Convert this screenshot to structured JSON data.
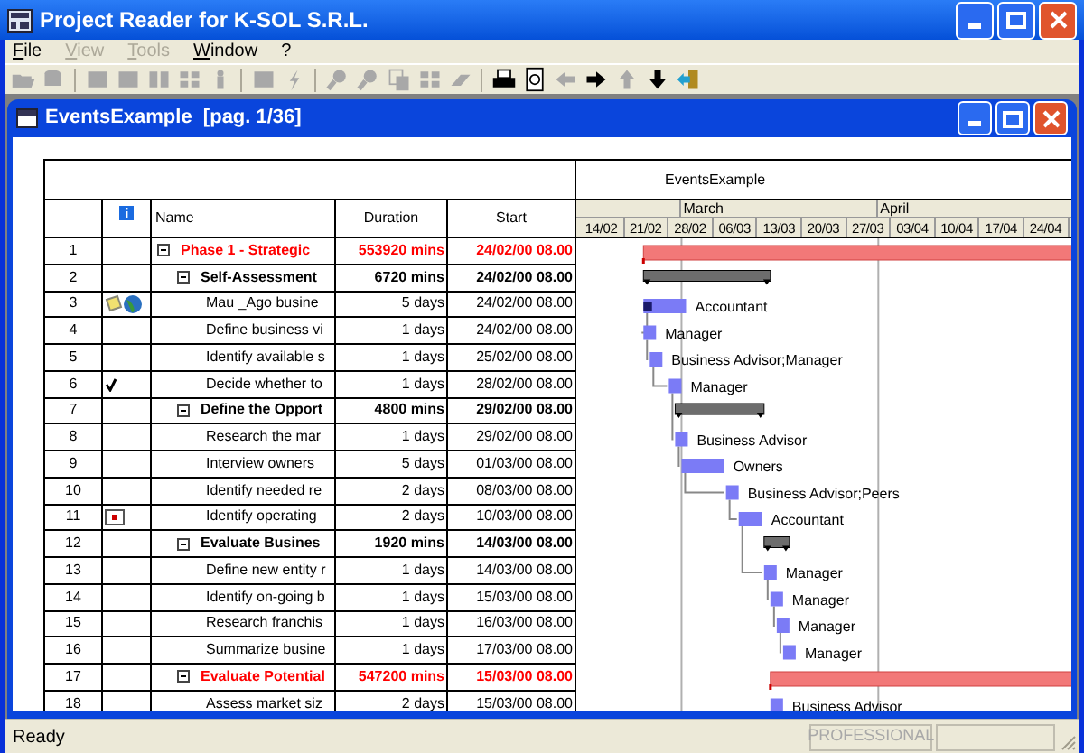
{
  "app": {
    "title": "Project Reader for K-SOL S.R.L."
  },
  "menu": [
    {
      "label": "File",
      "disabled": false
    },
    {
      "label": "View",
      "disabled": true
    },
    {
      "label": "Tools",
      "disabled": true
    },
    {
      "label": "Window",
      "disabled": false
    },
    {
      "label": "?",
      "disabled": false
    }
  ],
  "toolbar": [
    {
      "kind": "open",
      "disabled": true
    },
    {
      "kind": "database",
      "disabled": true
    },
    {
      "kind": "separator"
    },
    {
      "kind": "block",
      "disabled": true
    },
    {
      "kind": "block",
      "disabled": true
    },
    {
      "kind": "columns",
      "disabled": true
    },
    {
      "kind": "grid",
      "disabled": true
    },
    {
      "kind": "person",
      "disabled": true
    },
    {
      "kind": "separator"
    },
    {
      "kind": "block",
      "disabled": true
    },
    {
      "kind": "lightning",
      "disabled": true
    },
    {
      "kind": "separator"
    },
    {
      "kind": "zoom",
      "disabled": true
    },
    {
      "kind": "zoom",
      "disabled": true
    },
    {
      "kind": "copy",
      "disabled": true
    },
    {
      "kind": "grid",
      "disabled": true
    },
    {
      "kind": "eraser",
      "disabled": true
    },
    {
      "kind": "separator"
    },
    {
      "kind": "printer",
      "disabled": false
    },
    {
      "kind": "preview",
      "disabled": false
    },
    {
      "kind": "left",
      "disabled": true
    },
    {
      "kind": "right",
      "disabled": false
    },
    {
      "kind": "up",
      "disabled": true
    },
    {
      "kind": "down",
      "disabled": false
    },
    {
      "kind": "exit",
      "disabled": false
    }
  ],
  "document": {
    "title": "EventsExample  [pag. 1/36]",
    "gantt_title": "EventsExample",
    "columns": {
      "name": "Name",
      "duration": "Duration",
      "start": "Start"
    },
    "months": [
      "March",
      "April"
    ],
    "weeks": [
      "14/02",
      "21/02",
      "28/02",
      "06/03",
      "13/03",
      "20/03",
      "27/03",
      "03/04",
      "10/04",
      "17/04",
      "24/04"
    ],
    "rows": [
      {
        "number": "1",
        "kind": "summary",
        "critical": true,
        "expanded": true,
        "name": "Phase 1 - Strategic",
        "duration": "553920 mins",
        "start": "24/02/00 08.00",
        "children": [
          {
            "number": "2",
            "kind": "summary",
            "critical": false,
            "expanded": true,
            "name": "Self-Assessment",
            "duration": "6720 mins",
            "start": "24/02/00 08.00",
            "children": [
              {
                "number": "3",
                "kind": "task",
                "indicators": [
                  {
                    "kind": "note"
                  },
                  {
                    "kind": "globe"
                  }
                ],
                "name": "Mau _Ago busine",
                "duration": "5 days",
                "start": "24/02/00 08.00",
                "resource": "Accountant",
                "level": 0.2
              },
              {
                "number": "4",
                "kind": "task",
                "name": "Define business vi",
                "duration": "1 days",
                "start": "24/02/00 08.00",
                "resource": "Manager"
              },
              {
                "number": "5",
                "kind": "task",
                "name": "Identify available s",
                "duration": "1 days",
                "start": "25/02/00 08.00",
                "resource": "Business Advisor;Manager"
              },
              {
                "number": "6",
                "kind": "task",
                "indicators": [
                  {
                    "kind": "check"
                  }
                ],
                "name": "Decide whether to",
                "duration": "1 days",
                "start": "28/02/00 08.00",
                "resource": "Manager"
              }
            ]
          },
          {
            "number": "7",
            "kind": "summary",
            "critical": false,
            "expanded": true,
            "name": "Define the Opport",
            "duration": "4800 mins",
            "start": "29/02/00 08.00",
            "children": [
              {
                "number": "8",
                "kind": "task",
                "name": "Research the mar",
                "duration": "1 days",
                "start": "29/02/00 08.00",
                "resource": "Business Advisor"
              },
              {
                "number": "9",
                "kind": "task",
                "name": "Interview owners",
                "duration": "5 days",
                "start": "01/03/00 08.00",
                "resource": "Owners"
              },
              {
                "number": "10",
                "kind": "task",
                "name": "Identify needed re",
                "duration": "2 days",
                "start": "08/03/00 08.00",
                "resource": "Business Advisor;Peers"
              },
              {
                "number": "11",
                "kind": "task",
                "indicators": [
                  {
                    "kind": "calendar"
                  }
                ],
                "name": "Identify operating",
                "duration": "2 days",
                "start": "10/03/00 08.00",
                "resource": "Accountant"
              }
            ]
          },
          {
            "number": "12",
            "kind": "summary",
            "critical": false,
            "expanded": true,
            "name": "Evaluate Busines",
            "duration": "1920 mins",
            "start": "14/03/00 08.00",
            "children": [
              {
                "number": "13",
                "kind": "task",
                "name": "Define new entity r",
                "duration": "1 days",
                "start": "14/03/00 08.00",
                "resource": "Manager"
              },
              {
                "number": "14",
                "kind": "task",
                "name": "Identify on-going b",
                "duration": "1 days",
                "start": "15/03/00 08.00",
                "resource": "Manager"
              },
              {
                "number": "15",
                "kind": "task",
                "name": "Research franchis",
                "duration": "1 days",
                "start": "16/03/00 08.00",
                "resource": "Manager"
              },
              {
                "number": "16",
                "kind": "task",
                "name": "Summarize busine",
                "duration": "1 days",
                "start": "17/03/00 08.00",
                "resource": "Manager"
              }
            ]
          },
          {
            "number": "17",
            "kind": "summary",
            "critical": true,
            "expanded": true,
            "name": "Evaluate Potential",
            "duration": "547200 mins",
            "start": "15/03/00 08.00",
            "children": [
              {
                "number": "18",
                "kind": "task",
                "name": "Assess market siz",
                "duration": "2 days",
                "start": "15/03/00 08.00",
                "resource": "Business Advisor"
              }
            ]
          }
        ]
      }
    ]
  },
  "status_bar": {
    "message": "Ready",
    "panels": [
      "PROFESSIONAL"
    ]
  }
}
